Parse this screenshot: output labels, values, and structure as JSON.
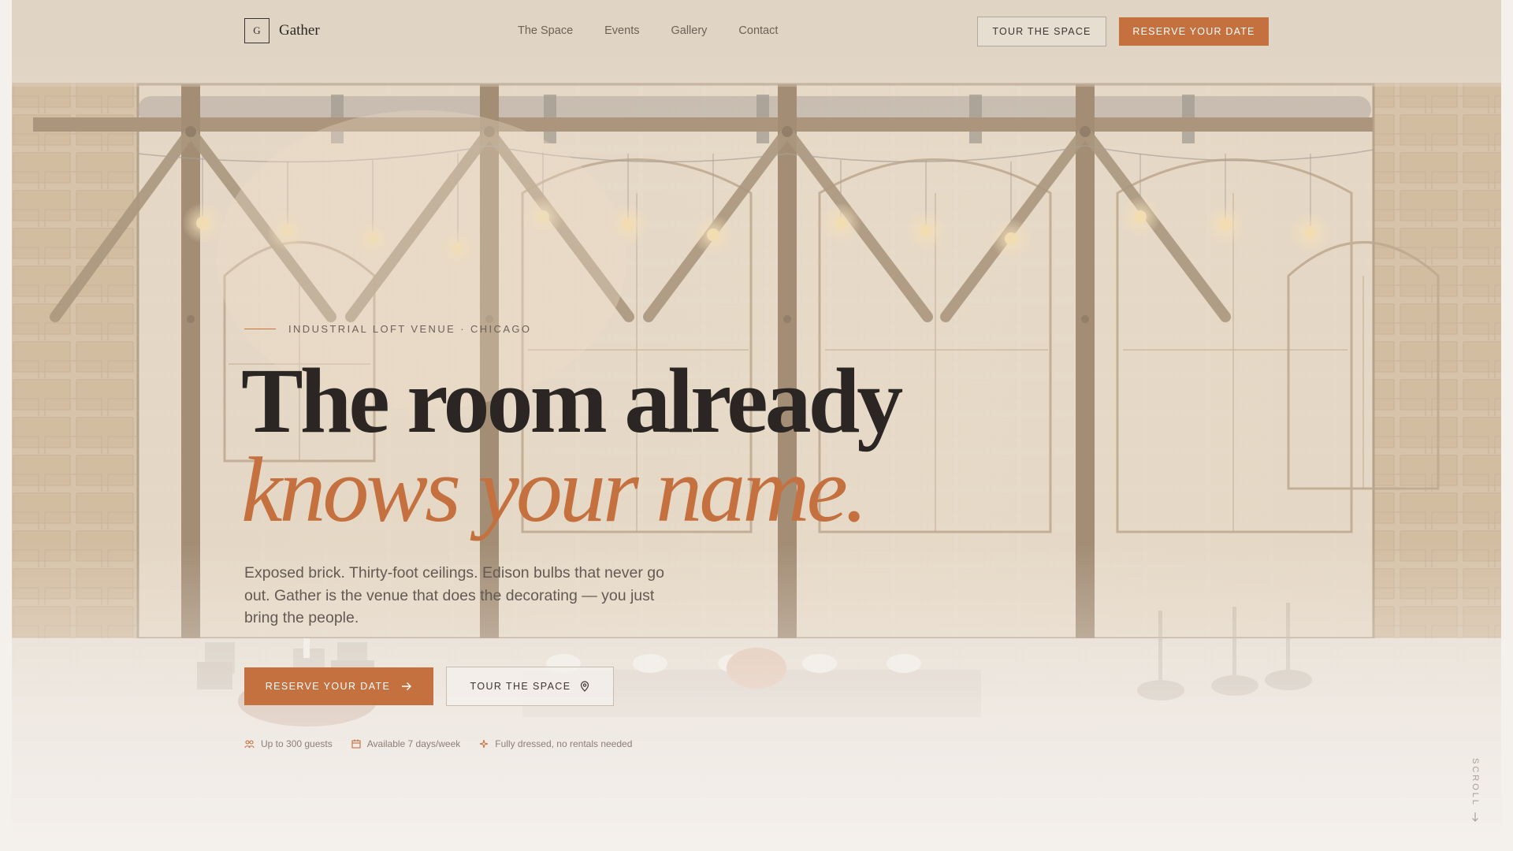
{
  "brand": {
    "mark": "G",
    "name": "Gather"
  },
  "nav": {
    "links": [
      "The Space",
      "Events",
      "Gallery",
      "Contact"
    ],
    "tour_label": "TOUR THE SPACE",
    "reserve_label": "RESERVE YOUR DATE"
  },
  "hero": {
    "eyebrow": "INDUSTRIAL LOFT VENUE · CHICAGO",
    "headline_line1": "The room already",
    "headline_line2": "knows your name.",
    "lede": "Exposed brick. Thirty-foot ceilings. Edison bulbs that never go out. Gather is the venue that does the decorating — you just bring the people.",
    "cta_primary": "RESERVE YOUR DATE",
    "cta_secondary": "TOUR THE SPACE",
    "features": [
      {
        "icon": "guests-icon",
        "label": "Up to 300 guests"
      },
      {
        "icon": "calendar-icon",
        "label": "Available 7 days/week"
      },
      {
        "icon": "sparkle-icon",
        "label": "Fully dressed, no rentals needed"
      }
    ]
  },
  "scroll_label": "SCROLL",
  "colors": {
    "accent": "#c4703f",
    "ink": "#2b2623",
    "brick": "#c9ae8c",
    "beam": "#7d6344",
    "paper": "#f4f0ec"
  }
}
